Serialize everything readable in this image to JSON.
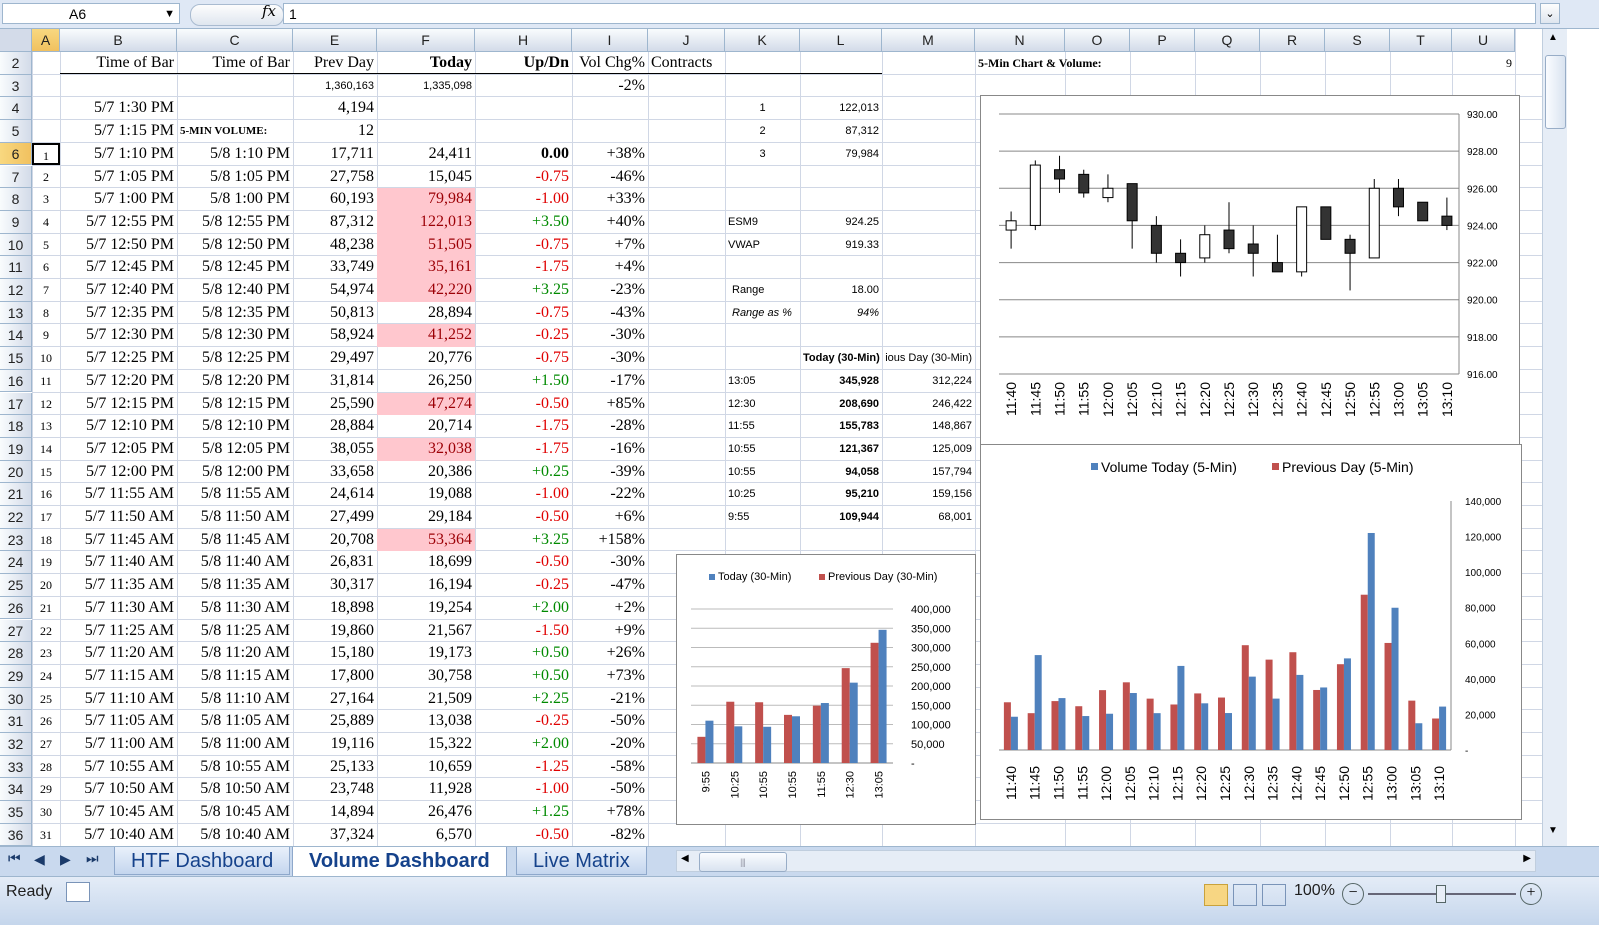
{
  "formula_bar": {
    "name_box": "A6",
    "fx_label": "fx",
    "value": "1"
  },
  "columns": [
    "A",
    "B",
    "C",
    "E",
    "F",
    "H",
    "I",
    "J",
    "K",
    "L",
    "M",
    "N",
    "O",
    "P",
    "Q",
    "R",
    "S",
    "T",
    "U"
  ],
  "rows": [
    "2",
    "3",
    "4",
    "5",
    "6",
    "7",
    "8",
    "9",
    "10",
    "11",
    "12",
    "13",
    "14",
    "15",
    "16",
    "17",
    "18",
    "19",
    "20",
    "21",
    "22",
    "23",
    "24",
    "25",
    "26",
    "27",
    "28",
    "29",
    "30",
    "31",
    "32",
    "33",
    "34",
    "35",
    "36"
  ],
  "headers": {
    "b": "Time of Bar",
    "c": "Time of Bar",
    "e": "Prev Day",
    "f": "Today",
    "h": "Up/Dn",
    "i": "Vol Chg%",
    "j": "Contracts"
  },
  "row3": {
    "e": "1,360,163",
    "f": "1,335,098",
    "i": "-2%"
  },
  "row4": {
    "b": "5/7 1:30 PM",
    "e": "4,194"
  },
  "row5": {
    "b": "5/7 1:15 PM",
    "c": "5-MIN VOLUME:",
    "e": "12"
  },
  "side_top": [
    {
      "k": "1",
      "l": "122,013"
    },
    {
      "k": "2",
      "l": "87,312"
    },
    {
      "k": "3",
      "l": "79,984"
    }
  ],
  "esm9": {
    "label": "ESM9",
    "value": "924.25"
  },
  "vwap": {
    "label": "VWAP",
    "value": "919.33"
  },
  "range": {
    "label": "Range",
    "value": "18.00"
  },
  "range_pct": {
    "label": "Range as %",
    "value": "94%"
  },
  "thirty_min_table": {
    "hdr_today": "Today (30-Min)",
    "hdr_prev": "ious Day (30-Min)",
    "rows": [
      {
        "t": "13:05",
        "today": "345,928",
        "prev": "312,224"
      },
      {
        "t": "12:30",
        "today": "208,690",
        "prev": "246,422"
      },
      {
        "t": "11:55",
        "today": "155,783",
        "prev": "148,867"
      },
      {
        "t": "10:55",
        "today": "121,367",
        "prev": "125,009"
      },
      {
        "t": "10:55",
        "today": "94,058",
        "prev": "157,794"
      },
      {
        "t": "10:25",
        "today": "95,210",
        "prev": "159,156"
      },
      {
        "t": "9:55",
        "today": "109,944",
        "prev": "68,001"
      }
    ]
  },
  "chart_title_cell": "5-Min Chart & Volume:",
  "cell_u2": "9",
  "data_rows": [
    {
      "a": "1",
      "b": "5/7 1:10 PM",
      "c": "5/8 1:10 PM",
      "e": "17,711",
      "f": "24,411",
      "h": "0.00",
      "i": "+38%",
      "hl": false,
      "dir": "z"
    },
    {
      "a": "2",
      "b": "5/7 1:05 PM",
      "c": "5/8 1:05 PM",
      "e": "27,758",
      "f": "15,045",
      "h": "-0.75",
      "i": "-46%",
      "hl": false,
      "dir": "d"
    },
    {
      "a": "3",
      "b": "5/7 1:00 PM",
      "c": "5/8 1:00 PM",
      "e": "60,193",
      "f": "79,984",
      "h": "-1.00",
      "i": "+33%",
      "hl": true,
      "dir": "d"
    },
    {
      "a": "4",
      "b": "5/7 12:55 PM",
      "c": "5/8 12:55 PM",
      "e": "87,312",
      "f": "122,013",
      "h": "+3.50",
      "i": "+40%",
      "hl": true,
      "dir": "u"
    },
    {
      "a": "5",
      "b": "5/7 12:50 PM",
      "c": "5/8 12:50 PM",
      "e": "48,238",
      "f": "51,505",
      "h": "-0.75",
      "i": "+7%",
      "hl": true,
      "dir": "d"
    },
    {
      "a": "6",
      "b": "5/7 12:45 PM",
      "c": "5/8 12:45 PM",
      "e": "33,749",
      "f": "35,161",
      "h": "-1.75",
      "i": "+4%",
      "hl": true,
      "dir": "d"
    },
    {
      "a": "7",
      "b": "5/7 12:40 PM",
      "c": "5/8 12:40 PM",
      "e": "54,974",
      "f": "42,220",
      "h": "+3.25",
      "i": "-23%",
      "hl": true,
      "dir": "u"
    },
    {
      "a": "8",
      "b": "5/7 12:35 PM",
      "c": "5/8 12:35 PM",
      "e": "50,813",
      "f": "28,894",
      "h": "-0.75",
      "i": "-43%",
      "hl": false,
      "dir": "d"
    },
    {
      "a": "9",
      "b": "5/7 12:30 PM",
      "c": "5/8 12:30 PM",
      "e": "58,924",
      "f": "41,252",
      "h": "-0.25",
      "i": "-30%",
      "hl": true,
      "dir": "d"
    },
    {
      "a": "10",
      "b": "5/7 12:25 PM",
      "c": "5/8 12:25 PM",
      "e": "29,497",
      "f": "20,776",
      "h": "-0.75",
      "i": "-30%",
      "hl": false,
      "dir": "d"
    },
    {
      "a": "11",
      "b": "5/7 12:20 PM",
      "c": "5/8 12:20 PM",
      "e": "31,814",
      "f": "26,250",
      "h": "+1.50",
      "i": "-17%",
      "hl": false,
      "dir": "u"
    },
    {
      "a": "12",
      "b": "5/7 12:15 PM",
      "c": "5/8 12:15 PM",
      "e": "25,590",
      "f": "47,274",
      "h": "-0.50",
      "i": "+85%",
      "hl": true,
      "dir": "d"
    },
    {
      "a": "13",
      "b": "5/7 12:10 PM",
      "c": "5/8 12:10 PM",
      "e": "28,884",
      "f": "20,714",
      "h": "-1.75",
      "i": "-28%",
      "hl": false,
      "dir": "d"
    },
    {
      "a": "14",
      "b": "5/7 12:05 PM",
      "c": "5/8 12:05 PM",
      "e": "38,055",
      "f": "32,038",
      "h": "-1.75",
      "i": "-16%",
      "hl": true,
      "dir": "d"
    },
    {
      "a": "15",
      "b": "5/7 12:00 PM",
      "c": "5/8 12:00 PM",
      "e": "33,658",
      "f": "20,386",
      "h": "+0.25",
      "i": "-39%",
      "hl": false,
      "dir": "u"
    },
    {
      "a": "16",
      "b": "5/7 11:55 AM",
      "c": "5/8 11:55 AM",
      "e": "24,614",
      "f": "19,088",
      "h": "-1.00",
      "i": "-22%",
      "hl": false,
      "dir": "d"
    },
    {
      "a": "17",
      "b": "5/7 11:50 AM",
      "c": "5/8 11:50 AM",
      "e": "27,499",
      "f": "29,184",
      "h": "-0.50",
      "i": "+6%",
      "hl": false,
      "dir": "d"
    },
    {
      "a": "18",
      "b": "5/7 11:45 AM",
      "c": "5/8 11:45 AM",
      "e": "20,708",
      "f": "53,364",
      "h": "+3.25",
      "i": "+158%",
      "hl": true,
      "dir": "u"
    },
    {
      "a": "19",
      "b": "5/7 11:40 AM",
      "c": "5/8 11:40 AM",
      "e": "26,831",
      "f": "18,699",
      "h": "-0.50",
      "i": "-30%",
      "hl": false,
      "dir": "d"
    },
    {
      "a": "20",
      "b": "5/7 11:35 AM",
      "c": "5/8 11:35 AM",
      "e": "30,317",
      "f": "16,194",
      "h": "-0.25",
      "i": "-47%",
      "hl": false,
      "dir": "d"
    },
    {
      "a": "21",
      "b": "5/7 11:30 AM",
      "c": "5/8 11:30 AM",
      "e": "18,898",
      "f": "19,254",
      "h": "+2.00",
      "i": "+2%",
      "hl": false,
      "dir": "u"
    },
    {
      "a": "22",
      "b": "5/7 11:25 AM",
      "c": "5/8 11:25 AM",
      "e": "19,860",
      "f": "21,567",
      "h": "-1.50",
      "i": "+9%",
      "hl": false,
      "dir": "d"
    },
    {
      "a": "23",
      "b": "5/7 11:20 AM",
      "c": "5/8 11:20 AM",
      "e": "15,180",
      "f": "19,173",
      "h": "+0.50",
      "i": "+26%",
      "hl": false,
      "dir": "u"
    },
    {
      "a": "24",
      "b": "5/7 11:15 AM",
      "c": "5/8 11:15 AM",
      "e": "17,800",
      "f": "30,758",
      "h": "+0.50",
      "i": "+73%",
      "hl": false,
      "dir": "u"
    },
    {
      "a": "25",
      "b": "5/7 11:10 AM",
      "c": "5/8 11:10 AM",
      "e": "27,164",
      "f": "21,509",
      "h": "+2.25",
      "i": "-21%",
      "hl": false,
      "dir": "u"
    },
    {
      "a": "26",
      "b": "5/7 11:05 AM",
      "c": "5/8 11:05 AM",
      "e": "25,889",
      "f": "13,038",
      "h": "-0.25",
      "i": "-50%",
      "hl": false,
      "dir": "d"
    },
    {
      "a": "27",
      "b": "5/7 11:00 AM",
      "c": "5/8 11:00 AM",
      "e": "19,116",
      "f": "15,322",
      "h": "+2.00",
      "i": "-20%",
      "hl": false,
      "dir": "u"
    },
    {
      "a": "28",
      "b": "5/7 10:55 AM",
      "c": "5/8 10:55 AM",
      "e": "25,133",
      "f": "10,659",
      "h": "-1.25",
      "i": "-58%",
      "hl": false,
      "dir": "d"
    },
    {
      "a": "29",
      "b": "5/7 10:50 AM",
      "c": "5/8 10:50 AM",
      "e": "23,748",
      "f": "11,928",
      "h": "-1.00",
      "i": "-50%",
      "hl": false,
      "dir": "d"
    },
    {
      "a": "30",
      "b": "5/7 10:45 AM",
      "c": "5/8 10:45 AM",
      "e": "14,894",
      "f": "26,476",
      "h": "+1.25",
      "i": "+78%",
      "hl": false,
      "dir": "u"
    },
    {
      "a": "31",
      "b": "5/7 10:40 AM",
      "c": "5/8 10:40 AM",
      "e": "37,324",
      "f": "6,570",
      "h": "-0.50",
      "i": "-82%",
      "hl": false,
      "dir": "d"
    }
  ],
  "tabs": [
    "HTF Dashboard",
    "Volume Dashboard",
    "Live Matrix"
  ],
  "active_tab": 1,
  "status": {
    "ready": "Ready",
    "zoom": "100%"
  },
  "colors": {
    "blue": "#4f81bd",
    "red": "#c0504d",
    "green": "#008a00",
    "down": "#e00000",
    "highlight": "#ffc7ce"
  },
  "chart_data": [
    {
      "type": "candlestick",
      "categories": [
        "11:40",
        "11:45",
        "11:50",
        "11:55",
        "12:00",
        "12:05",
        "12:10",
        "12:15",
        "12:20",
        "12:25",
        "12:30",
        "12:35",
        "12:40",
        "12:45",
        "12:50",
        "12:55",
        "13:00",
        "13:05",
        "13:10"
      ],
      "ohlc": [
        [
          923.75,
          924.75,
          922.75,
          924.25
        ],
        [
          924.0,
          927.5,
          923.75,
          927.25
        ],
        [
          927.0,
          927.75,
          925.75,
          926.5
        ],
        [
          926.75,
          927.0,
          925.5,
          925.75
        ],
        [
          925.5,
          926.75,
          925.25,
          926.0
        ],
        [
          926.25,
          926.25,
          922.75,
          924.25
        ],
        [
          924.0,
          924.5,
          922.0,
          922.5
        ],
        [
          922.5,
          923.25,
          921.25,
          922.0
        ],
        [
          922.25,
          924.0,
          922.0,
          923.5
        ],
        [
          923.75,
          925.25,
          922.5,
          922.75
        ],
        [
          923.0,
          924.0,
          921.25,
          922.5
        ],
        [
          922.0,
          923.5,
          921.5,
          921.5
        ],
        [
          921.5,
          925.0,
          921.25,
          925.0
        ],
        [
          925.0,
          925.0,
          923.25,
          923.25
        ],
        [
          923.25,
          923.5,
          920.5,
          922.5
        ],
        [
          922.25,
          926.5,
          922.25,
          926.0
        ],
        [
          926.0,
          926.5,
          924.5,
          925.0
        ],
        [
          925.25,
          925.25,
          924.25,
          924.25
        ],
        [
          924.5,
          925.5,
          923.75,
          924.0
        ]
      ],
      "ylim": [
        916,
        930
      ],
      "yticks": [
        "916.00",
        "918.00",
        "920.00",
        "922.00",
        "924.00",
        "926.00",
        "928.00",
        "930.00"
      ]
    },
    {
      "type": "bar",
      "categories": [
        "11:40",
        "11:45",
        "11:50",
        "11:55",
        "12:00",
        "12:05",
        "12:10",
        "12:15",
        "12:20",
        "12:25",
        "12:30",
        "12:35",
        "12:40",
        "12:45",
        "12:50",
        "12:55",
        "13:00",
        "13:05",
        "13:10"
      ],
      "series": [
        {
          "name": "Previous Day (5-Min)",
          "values": [
            26831,
            20708,
            27499,
            24614,
            33658,
            38055,
            28884,
            25590,
            31814,
            29497,
            58924,
            50813,
            54974,
            33749,
            48238,
            87312,
            60193,
            27758,
            17711
          ]
        },
        {
          "name": "Volume Today (5-Min)",
          "values": [
            18699,
            53364,
            29184,
            19088,
            20386,
            32038,
            20714,
            47274,
            26250,
            20776,
            41252,
            28894,
            42220,
            35161,
            51505,
            122013,
            79984,
            15045,
            24411
          ]
        }
      ],
      "ylim": [
        0,
        140000
      ],
      "yticks": [
        "-",
        "20,000",
        "40,000",
        "60,000",
        "80,000",
        "100,000",
        "120,000",
        "140,000"
      ]
    },
    {
      "type": "bar",
      "categories": [
        "9:55",
        "10:25",
        "10:55",
        "10:55",
        "11:55",
        "12:30",
        "13:05"
      ],
      "series": [
        {
          "name": "Previous Day (30-Min)",
          "values": [
            68001,
            159156,
            157794,
            125009,
            148867,
            246422,
            312224
          ]
        },
        {
          "name": "Today (30-Min)",
          "values": [
            109944,
            95210,
            94058,
            121367,
            155783,
            208690,
            345928
          ]
        }
      ],
      "ylim": [
        0,
        400000
      ],
      "yticks": [
        "-",
        "50,000",
        "100,000",
        "150,000",
        "200,000",
        "250,000",
        "300,000",
        "350,000",
        "400,000"
      ]
    }
  ]
}
